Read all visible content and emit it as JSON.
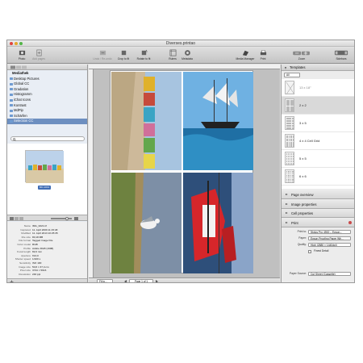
{
  "window": {
    "title": "Diverses.printao"
  },
  "toolbar": {
    "left": [
      {
        "label": "Photo",
        "icon": "photo-icon"
      },
      {
        "label": "Add pages",
        "icon": "add-pages-icon"
      }
    ],
    "center": [
      {
        "label": "Undo / Re-undo",
        "icon": "undo-icon"
      },
      {
        "label": "Crop to fit",
        "icon": "crop-icon"
      },
      {
        "label": "Rotate to fit",
        "icon": "rotate-icon"
      },
      {
        "label": "Rulers",
        "icon": "ruler-icon"
      },
      {
        "label": "Metadata",
        "icon": "metadata-icon"
      }
    ],
    "right": [
      {
        "label": "Media Manager",
        "icon": "media-manager-icon"
      },
      {
        "label": "Print",
        "icon": "print-icon"
      },
      {
        "label": "Zoom",
        "icon": "zoom-icon"
      },
      {
        "label": "Sidebars",
        "icon": "sidebars-icon"
      }
    ]
  },
  "library": {
    "root": "Mediathek",
    "items": [
      "Desktop Pictures",
      "Global CC",
      "Gradation",
      "Histogramm",
      "iChat Icons",
      "Kontrast",
      "MdPip",
      "Schärfen",
      "Selection CC"
    ],
    "selected_index": 8
  },
  "thumbnail": {
    "badge": "MC-1013"
  },
  "info": {
    "rows": [
      {
        "k": "Name",
        "v": "IMG_0221.tif"
      },
      {
        "k": "Captured",
        "v": "11. April 2009 11:15:48"
      },
      {
        "k": "Modified",
        "v": "11. April 2013 10:25:35"
      },
      {
        "k": "File size",
        "v": "80,18 MB"
      },
      {
        "k": "File format",
        "v": "Tagged Image File"
      },
      {
        "k": "Color model",
        "v": "RGB"
      },
      {
        "k": "Profile",
        "v": "Adobe RGB (1998)"
      },
      {
        "k": "Focal length",
        "v": "82,0 mm"
      },
      {
        "k": "Aperture",
        "v": "f/13,0"
      },
      {
        "k": "Shutter speed",
        "v": "1/100 s"
      },
      {
        "k": "Sensitivity",
        "v": "ISO 100"
      },
      {
        "k": "Image size",
        "v": "50,8 × 37,4 cm"
      },
      {
        "k": "Pixel size",
        "v": "3744 × 5616"
      },
      {
        "k": "Resolution",
        "v": "240 ppi"
      }
    ]
  },
  "canvas": {
    "fit_label": "Fit to...",
    "page_label": "Page 1 of 1"
  },
  "templates": {
    "header": "Templates",
    "filter": "All",
    "items": [
      {
        "name": "13 x 18\""
      },
      {
        "name": "2 x 2"
      },
      {
        "name": "3 x 5"
      },
      {
        "name": "4 x 4 Cell Grid"
      },
      {
        "name": "5 x 5"
      },
      {
        "name": "6 x 6"
      }
    ],
    "selected_index": 1
  },
  "accordion": [
    "Page overview",
    "Image properties",
    "Cell properties",
    "Print"
  ],
  "print": {
    "rows": [
      {
        "k": "Print to:",
        "v": "Stylus Pro 4900 – Epson..."
      },
      {
        "k": "Paper:",
        "v": "Epson Proofing Paper Wh..."
      },
      {
        "k": "Quality:",
        "v": "High (2880 × 1440dpi)"
      }
    ],
    "finest_detail": "Finest Detail",
    "paper_source_label": "Paper Source:",
    "paper_source_value": "Cut Sheet (Cassette)"
  },
  "colors": {
    "accent": "#6d8fc0",
    "close": "#e0443e",
    "minimize": "#e5a72a",
    "zoom": "#53b548"
  }
}
